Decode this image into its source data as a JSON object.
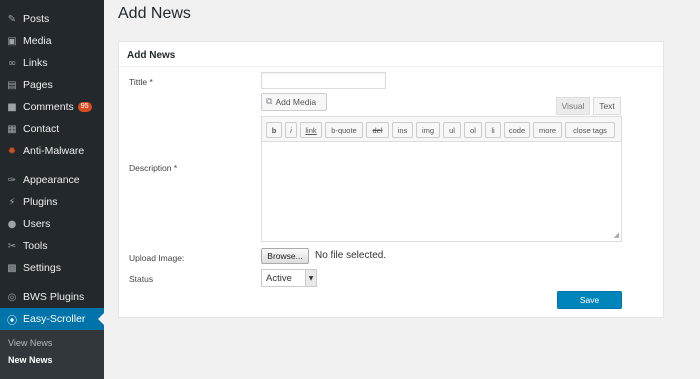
{
  "sidebar": {
    "items": [
      {
        "label": "Posts",
        "icon": "pushpin-icon",
        "glyph": "✎"
      },
      {
        "label": "Media",
        "icon": "media-icon",
        "glyph": "▣"
      },
      {
        "label": "Links",
        "icon": "link-icon",
        "glyph": "∞"
      },
      {
        "label": "Pages",
        "icon": "pages-icon",
        "glyph": "▤"
      },
      {
        "label": "Comments",
        "icon": "comments-icon",
        "glyph": "■",
        "badge": "95"
      },
      {
        "label": "Contact",
        "icon": "contact-icon",
        "glyph": "▦"
      },
      {
        "label": "Anti-Malware",
        "icon": "anti-malware-icon",
        "glyph": "✹"
      },
      {
        "label": "Appearance",
        "icon": "appearance-icon",
        "glyph": "✑"
      },
      {
        "label": "Plugins",
        "icon": "plugins-icon",
        "glyph": "⚡"
      },
      {
        "label": "Users",
        "icon": "users-icon",
        "glyph": "●"
      },
      {
        "label": "Tools",
        "icon": "tools-icon",
        "glyph": "✂"
      },
      {
        "label": "Settings",
        "icon": "settings-icon",
        "glyph": "▩"
      },
      {
        "label": "BWS Plugins",
        "icon": "bws-plugins-icon",
        "glyph": "◎"
      },
      {
        "label": "Easy-Scroller",
        "icon": "easy-scroller-icon",
        "glyph": "⦿",
        "active": true
      }
    ],
    "submenu": [
      {
        "label": "View News"
      },
      {
        "label": "New News",
        "current": true
      }
    ]
  },
  "page": {
    "title": "Add News"
  },
  "panel": {
    "title": "Add News",
    "fields": {
      "title_label": "Tittle *",
      "title_value": "",
      "description_label": "Description *",
      "upload_label": "Upload Image:",
      "status_label": "Status"
    },
    "add_media_label": "Add Media",
    "tabs": {
      "visual": "Visual",
      "text": "Text"
    },
    "toolbar": [
      "b",
      "i",
      "link",
      "b-quote",
      "del",
      "ins",
      "img",
      "ul",
      "ol",
      "li",
      "code",
      "more",
      "close tags"
    ],
    "browse_label": "Browse...",
    "file_status": "No file selected.",
    "status_value": "Active",
    "save_label": "Save"
  },
  "colors": {
    "sidebar_bg": "#23282d",
    "active_bg": "#0073aa",
    "save_bg": "#0085ba",
    "badge_bg": "#d54e21"
  }
}
